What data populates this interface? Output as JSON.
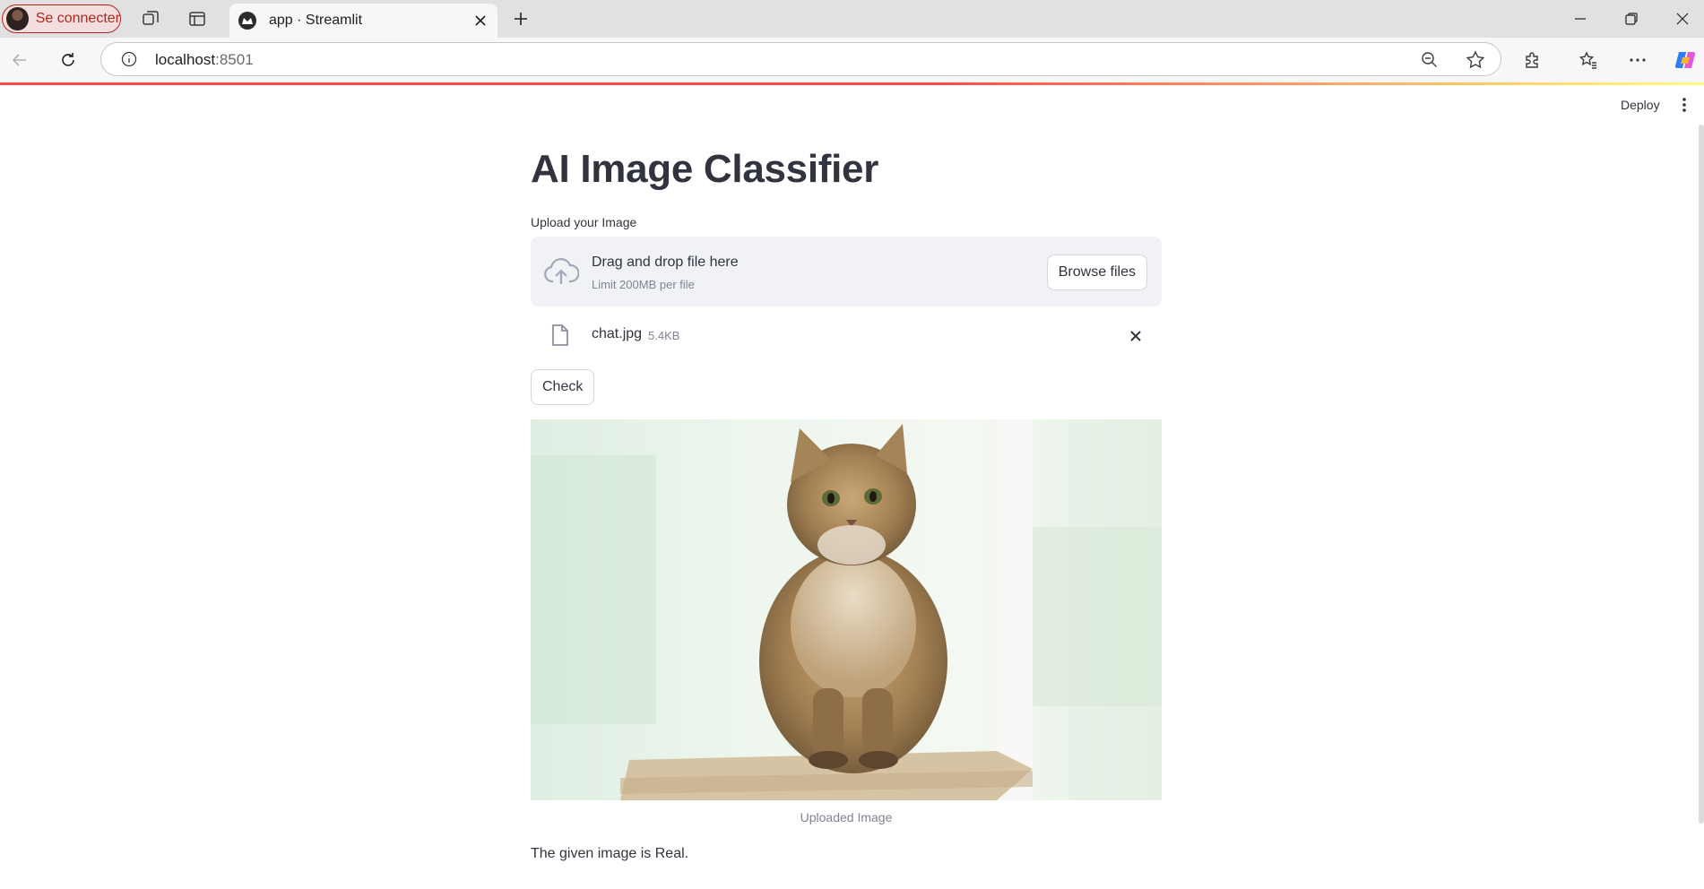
{
  "browser": {
    "profile_label": "Se connecter",
    "tab_title": "app · Streamlit",
    "url_host": "localhost",
    "url_port": ":8501"
  },
  "header": {
    "deploy_label": "Deploy"
  },
  "main": {
    "title": "AI Image Classifier",
    "uploader": {
      "label": "Upload your Image",
      "drop_text": "Drag and drop file here",
      "limit_text": "Limit 200MB per file",
      "browse_label": "Browse files"
    },
    "uploaded_file": {
      "name": "chat.jpg",
      "size": "5.4KB"
    },
    "check_label": "Check",
    "image_caption": "Uploaded Image",
    "result": "The given image is Real."
  },
  "colors": {
    "accent": "#ff4b4b",
    "text": "#31333f",
    "muted": "#808495",
    "dropzone_bg": "#f0f2f6"
  }
}
